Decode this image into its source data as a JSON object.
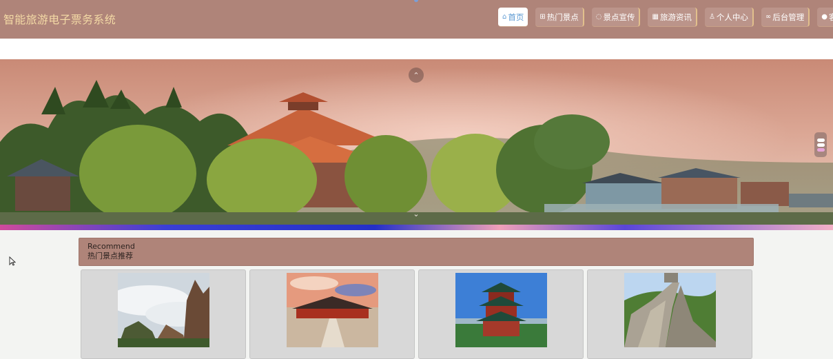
{
  "header": {
    "brand": "智能旅游电子票务系统",
    "nav": [
      {
        "icon": "home-icon",
        "glyph": "⌂",
        "label": "首页",
        "active": true
      },
      {
        "icon": "ticket-icon",
        "glyph": "⊞",
        "label": "热门景点",
        "active": false
      },
      {
        "icon": "tag-icon",
        "glyph": "◌",
        "label": "景点宣传",
        "active": false
      },
      {
        "icon": "news-icon",
        "glyph": "▦",
        "label": "旅游资讯",
        "active": false
      },
      {
        "icon": "user-icon",
        "glyph": "♙",
        "label": "个人中心",
        "active": false
      },
      {
        "icon": "link-icon",
        "glyph": "∞",
        "label": "后台管理",
        "active": false
      },
      {
        "icon": "service-icon",
        "glyph": "●",
        "label": "客服",
        "active": false
      }
    ]
  },
  "banner": {
    "up_glyph": "⌃",
    "down_glyph": "⌄",
    "slides": 3,
    "active_slide": 3
  },
  "recommend": {
    "title_en": "Recommend",
    "title_cn": "热门景点推荐"
  },
  "spots": [
    {
      "scene": "misty-mountains"
    },
    {
      "scene": "imperial-palace"
    },
    {
      "scene": "pagoda-tower"
    },
    {
      "scene": "great-wall"
    }
  ],
  "colors": {
    "header_bg": "#af8479",
    "brand_text": "#f3d9a5",
    "active_nav_text": "#5d9ad2",
    "card_bg": "#d8d8d8"
  }
}
